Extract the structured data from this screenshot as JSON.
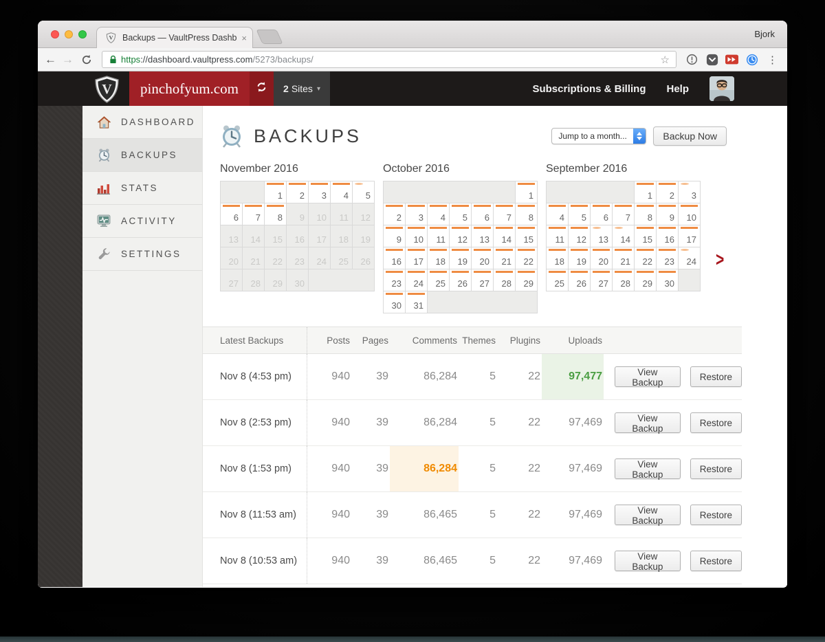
{
  "browser": {
    "tab": {
      "title": "Backups — VaultPress Dashbo",
      "close_label": "×"
    },
    "user_label": "Bjork",
    "url": {
      "scheme": "https",
      "host": "://dashboard.vaultpress.com",
      "path": "/5273/backups/"
    }
  },
  "vp_topbar": {
    "site_name": "pinchofyum.com",
    "sites_count": "2",
    "sites_label": "Sites",
    "links": [
      {
        "label": "Subscriptions & Billing"
      },
      {
        "label": "Help"
      }
    ],
    "colors": {
      "bar": "#1d1a19",
      "site_red": "#a02026",
      "refresh_red": "#8a191d",
      "sites_bg": "#3a3a3a"
    }
  },
  "sidebar": {
    "items": [
      {
        "label": "DASHBOARD",
        "icon": "home-icon",
        "active": false
      },
      {
        "label": "BACKUPS",
        "icon": "alarm-clock-icon",
        "active": true
      },
      {
        "label": "STATS",
        "icon": "bar-chart-icon",
        "active": false
      },
      {
        "label": "ACTIVITY",
        "icon": "activity-monitor-icon",
        "active": false
      },
      {
        "label": "SETTINGS",
        "icon": "wrench-icon",
        "active": false
      }
    ]
  },
  "main": {
    "title": "BACKUPS",
    "title_icon": "alarm-clock-icon",
    "month_select_value": "Jump to a month...",
    "backup_now_label": "Backup Now",
    "next_arrow": ">"
  },
  "calendars": [
    {
      "title": "November 2016",
      "weeks": [
        [
          {
            "e": 2
          },
          {
            "d": 1
          },
          {
            "d": 2
          },
          {
            "d": 3
          },
          {
            "d": 4
          },
          {
            "d": 5,
            "l": true
          }
        ],
        [
          {
            "d": 6
          },
          {
            "d": 7
          },
          {
            "d": 8
          },
          {
            "d": 9,
            "x": true
          },
          {
            "d": 10,
            "x": true
          },
          {
            "d": 11,
            "x": true
          },
          {
            "d": 12,
            "x": true
          }
        ],
        [
          {
            "d": 13,
            "x": true
          },
          {
            "d": 14,
            "x": true
          },
          {
            "d": 15,
            "x": true
          },
          {
            "d": 16,
            "x": true
          },
          {
            "d": 17,
            "x": true
          },
          {
            "d": 18,
            "x": true
          },
          {
            "d": 19,
            "x": true
          }
        ],
        [
          {
            "d": 20,
            "x": true
          },
          {
            "d": 21,
            "x": true
          },
          {
            "d": 22,
            "x": true
          },
          {
            "d": 23,
            "x": true
          },
          {
            "d": 24,
            "x": true
          },
          {
            "d": 25,
            "x": true
          },
          {
            "d": 26,
            "x": true
          }
        ],
        [
          {
            "d": 27,
            "x": true
          },
          {
            "d": 28,
            "x": true
          },
          {
            "d": 29,
            "x": true
          },
          {
            "d": 30,
            "x": true
          },
          {
            "e": 3
          }
        ]
      ]
    },
    {
      "title": "October 2016",
      "weeks": [
        [
          {
            "e": 6
          },
          {
            "d": 1
          }
        ],
        [
          {
            "d": 2
          },
          {
            "d": 3
          },
          {
            "d": 4
          },
          {
            "d": 5
          },
          {
            "d": 6
          },
          {
            "d": 7
          },
          {
            "d": 8
          }
        ],
        [
          {
            "d": 9
          },
          {
            "d": 10
          },
          {
            "d": 11
          },
          {
            "d": 12
          },
          {
            "d": 13
          },
          {
            "d": 14
          },
          {
            "d": 15
          }
        ],
        [
          {
            "d": 16
          },
          {
            "d": 17
          },
          {
            "d": 18
          },
          {
            "d": 19
          },
          {
            "d": 20
          },
          {
            "d": 21
          },
          {
            "d": 22
          }
        ],
        [
          {
            "d": 23
          },
          {
            "d": 24
          },
          {
            "d": 25
          },
          {
            "d": 26
          },
          {
            "d": 27
          },
          {
            "d": 28
          },
          {
            "d": 29
          }
        ],
        [
          {
            "d": 30
          },
          {
            "d": 31
          },
          {
            "e": 5
          }
        ]
      ]
    },
    {
      "title": "September 2016",
      "weeks": [
        [
          {
            "e": 4
          },
          {
            "d": 1
          },
          {
            "d": 2
          },
          {
            "d": 3,
            "l": true
          }
        ],
        [
          {
            "d": 4
          },
          {
            "d": 5
          },
          {
            "d": 6
          },
          {
            "d": 7
          },
          {
            "d": 8
          },
          {
            "d": 9
          },
          {
            "d": 10
          }
        ],
        [
          {
            "d": 11
          },
          {
            "d": 12
          },
          {
            "d": 13,
            "l": true
          },
          {
            "d": 14,
            "l": true
          },
          {
            "d": 15
          },
          {
            "d": 16
          },
          {
            "d": 17
          }
        ],
        [
          {
            "d": 18
          },
          {
            "d": 19
          },
          {
            "d": 20
          },
          {
            "d": 21
          },
          {
            "d": 22
          },
          {
            "d": 23
          },
          {
            "d": 24,
            "l": true
          }
        ],
        [
          {
            "d": 25
          },
          {
            "d": 26
          },
          {
            "d": 27
          },
          {
            "d": 28
          },
          {
            "d": 29
          },
          {
            "d": 30
          },
          {
            "e": 1
          }
        ]
      ]
    }
  ],
  "table": {
    "headers": [
      "Latest Backups",
      "Posts",
      "Pages",
      "Comments",
      "Themes",
      "Plugins",
      "Uploads"
    ],
    "rows": [
      {
        "date": "Nov 8 (4:53 pm)",
        "posts": "940",
        "pages": "39",
        "comments": "86,284",
        "themes": "5",
        "plugins": "22",
        "uploads": "97,477",
        "highlight_col": "uploads",
        "highlight_type": "green"
      },
      {
        "date": "Nov 8 (2:53 pm)",
        "posts": "940",
        "pages": "39",
        "comments": "86,284",
        "themes": "5",
        "plugins": "22",
        "uploads": "97,469"
      },
      {
        "date": "Nov 8 (1:53 pm)",
        "posts": "940",
        "pages": "39",
        "comments": "86,284",
        "themes": "5",
        "plugins": "22",
        "uploads": "97,469",
        "highlight_col": "comments",
        "highlight_type": "orange"
      },
      {
        "date": "Nov 8 (11:53 am)",
        "posts": "940",
        "pages": "39",
        "comments": "86,465",
        "themes": "5",
        "plugins": "22",
        "uploads": "97,469"
      },
      {
        "date": "Nov 8 (10:53 am)",
        "posts": "940",
        "pages": "39",
        "comments": "86,465",
        "themes": "5",
        "plugins": "22",
        "uploads": "97,469"
      }
    ],
    "actions": {
      "view": "View Backup",
      "restore": "Restore"
    }
  },
  "colors": {
    "calendar_bar_strong": "#ef8c43",
    "calendar_bar_light": "#f6bd8e",
    "uploads_green_text": "#4a9e42",
    "uploads_green_bg": "#eaf3e6",
    "comments_orange_text": "#f08a00",
    "comments_orange_bg": "#fdf3e3"
  }
}
